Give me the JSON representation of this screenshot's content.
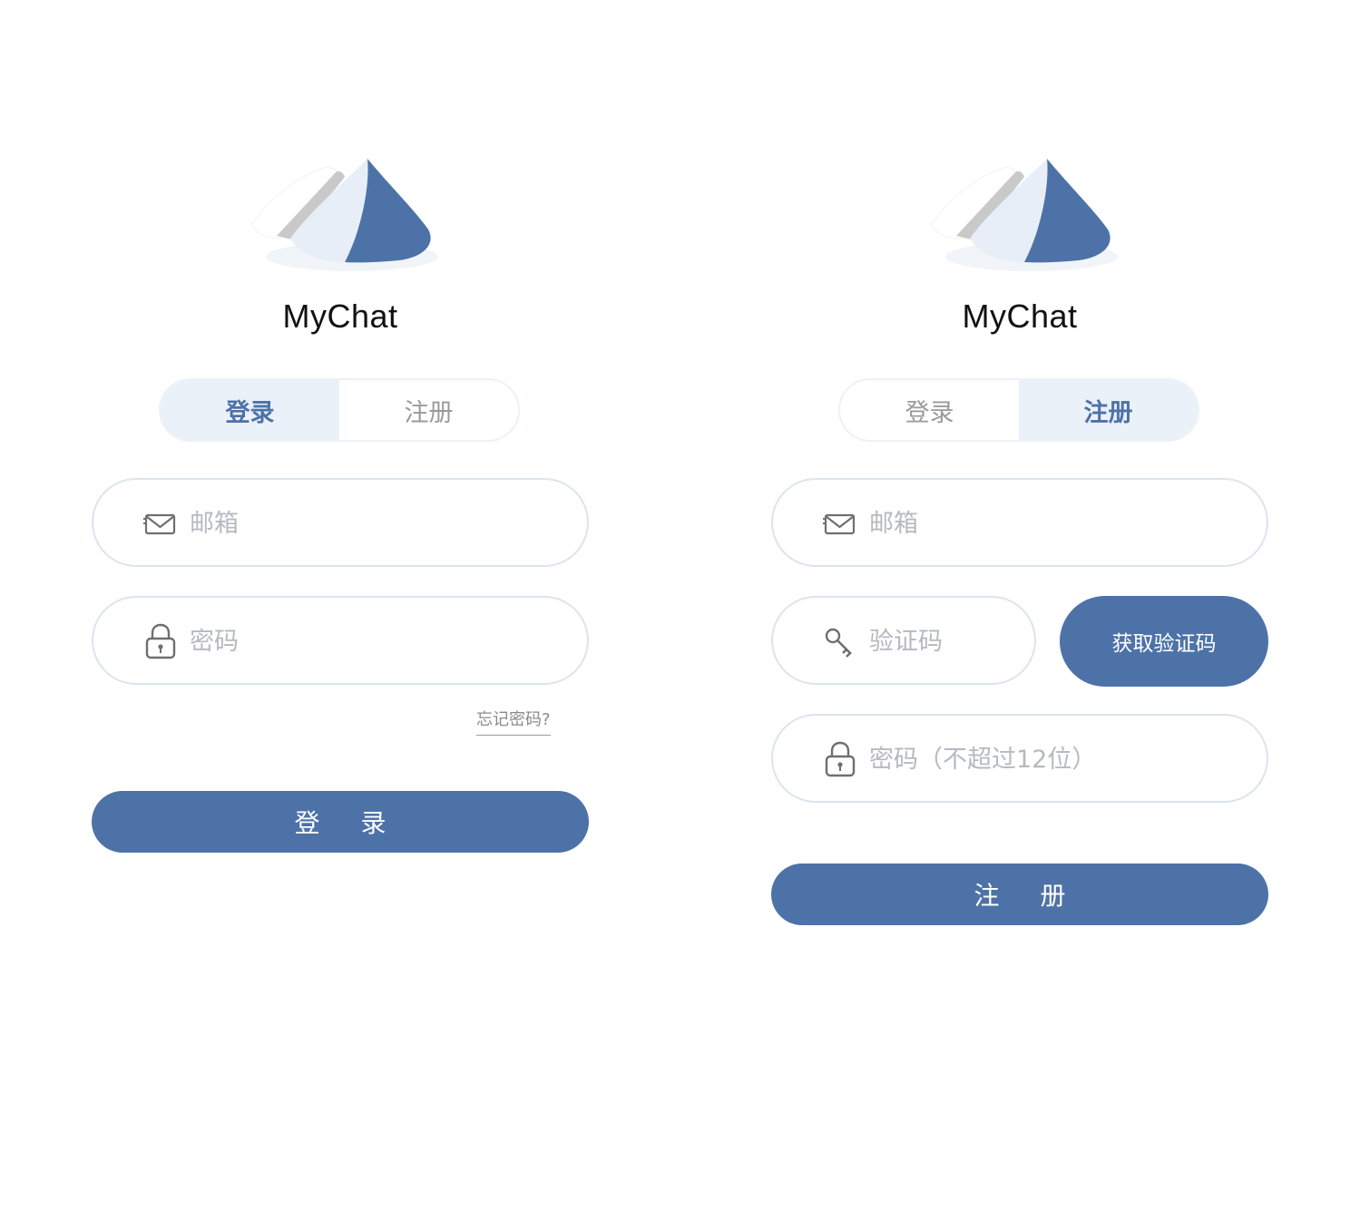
{
  "colors": {
    "accent": "#4d72a8",
    "tab_active_bg": "#ebf1f9",
    "field_border": "#dbe4ef",
    "placeholder": "#b6b9c0"
  },
  "login_screen": {
    "app_name": "MyChat",
    "tabs": [
      {
        "label": "登录",
        "active": true
      },
      {
        "label": "注册",
        "active": false
      }
    ],
    "email": {
      "placeholder": "邮箱",
      "icon": "mail-icon"
    },
    "password": {
      "placeholder": "密码",
      "icon": "lock-icon"
    },
    "forgot_password": "忘记密码?",
    "submit_label": "登 录"
  },
  "register_screen": {
    "app_name": "MyChat",
    "tabs": [
      {
        "label": "登录",
        "active": false
      },
      {
        "label": "注册",
        "active": true
      }
    ],
    "email": {
      "placeholder": "邮箱",
      "icon": "mail-icon"
    },
    "code": {
      "placeholder": "验证码",
      "icon": "key-icon"
    },
    "get_code_label": "获取验证码",
    "password": {
      "placeholder": "密码（不超过12位）",
      "icon": "lock-icon"
    },
    "submit_label": "注 册"
  }
}
